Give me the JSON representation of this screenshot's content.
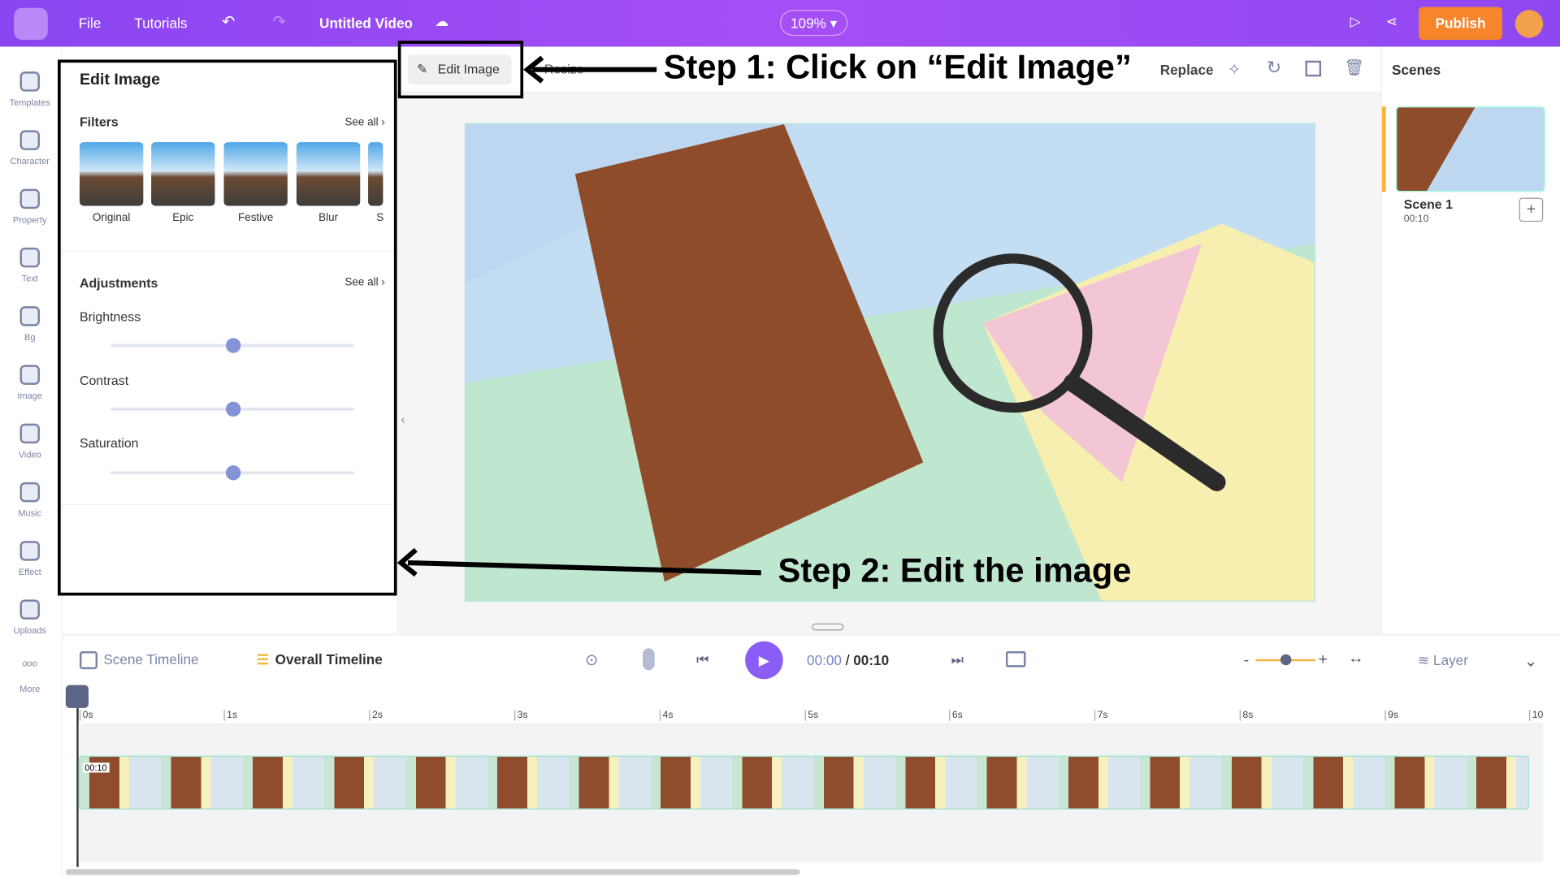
{
  "topbar": {
    "menu": [
      "File",
      "Tutorials"
    ],
    "title": "Untitled Video",
    "zoom": "109%",
    "publish": "Publish"
  },
  "sidebar": [
    "Templates",
    "Character",
    "Property",
    "Text",
    "Bg",
    "Image",
    "Video",
    "Music",
    "Effect",
    "Uploads",
    "More"
  ],
  "panel": {
    "title": "Edit Image",
    "filters_label": "Filters",
    "see_all": "See all",
    "filters": [
      "Original",
      "Epic",
      "Festive",
      "Blur",
      "S"
    ],
    "adjustments_label": "Adjustments",
    "sliders": [
      {
        "label": "Brightness",
        "value": 0.5
      },
      {
        "label": "Contrast",
        "value": 0.5
      },
      {
        "label": "Saturation",
        "value": 0.5
      }
    ]
  },
  "toolbar": {
    "edit_image": "Edit Image",
    "resize": "Resize",
    "replace": "Replace"
  },
  "scenes": {
    "title": "Scenes",
    "scene_name": "Scene 1",
    "scene_time": "00:10"
  },
  "callouts": {
    "step1": "Step 1: Click on “Edit Image”",
    "step2": "Step 2: Edit the image"
  },
  "timeline": {
    "scene_tab": "Scene Timeline",
    "overall_tab": "Overall Timeline",
    "current": "00:00",
    "sep": " / ",
    "total": "00:10",
    "layer": "Layer",
    "ticks": [
      "0s",
      "1s",
      "2s",
      "3s",
      "4s",
      "5s",
      "6s",
      "7s",
      "8s",
      "9s",
      "10"
    ],
    "clip_time": "00:10"
  },
  "colors": {
    "accent": "#8a45f0",
    "publish": "#f6852b",
    "play": "#8b5cf6"
  }
}
